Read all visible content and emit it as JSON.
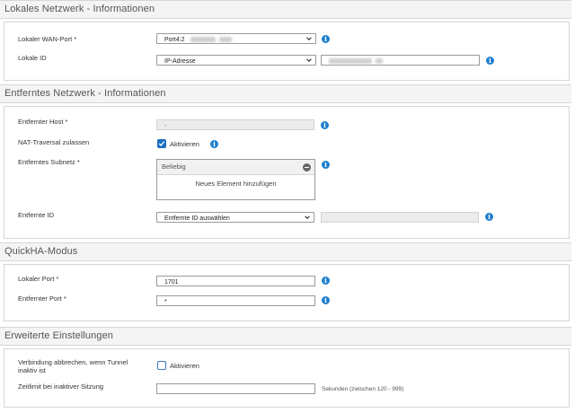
{
  "sections": {
    "local": {
      "title": "Lokales Netzwerk - Informationen",
      "wan_port_label": "Lokaler WAN-Port *",
      "wan_port_value": "Port4:2",
      "local_id_label": "Lokale ID",
      "local_id_type": "IP-Adresse"
    },
    "remote": {
      "title": "Entferntes Netzwerk - Informationen",
      "host_label": "Entfernter Host *",
      "host_value": "-",
      "nat_label": "NAT-Traversal zulassen",
      "nat_checkbox_label": "Aktivieren",
      "subnet_label": "Entferntes Subnetz *",
      "subnet_item": "Beliebig",
      "subnet_add_label": "Neues Element hinzufügen",
      "remote_id_label": "Entfernte ID",
      "remote_id_select": "Entfernte ID auswählen"
    },
    "quickha": {
      "title": "QuickHA-Modus",
      "local_port_label": "Lokaler Port *",
      "local_port_value": "1701",
      "remote_port_label": "Entfernter Port *",
      "remote_port_value": "*"
    },
    "advanced": {
      "title": "Erweiterte Einstellungen",
      "disconnect_label_line1": "Verbindung abbrechen, wenn Tunnel",
      "disconnect_label_line2": "inaktiv ist",
      "disconnect_checkbox_label": "Aktivieren",
      "timeout_label": "Zeitlimit bei inaktiver Sitzung",
      "timeout_hint": "Sekunden (zwischen 120 - 999)"
    }
  },
  "info_icon_glyph": "i",
  "colors": {
    "accent_blue": "#1f7fcf",
    "checkbox_blue": "#1b6fc0",
    "header_bg": "#f4f4f4",
    "border": "#d6d6d6"
  }
}
